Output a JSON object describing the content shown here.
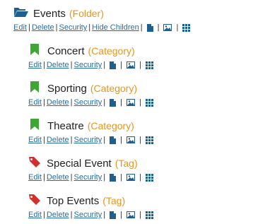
{
  "folder": {
    "name": "Events",
    "type": "(Folder)",
    "icon": "folder-open-icon",
    "actions": [
      "Edit",
      "Delete",
      "Security",
      "Hide Children"
    ]
  },
  "children": [
    {
      "name": "Concert",
      "type": "(Category)",
      "icon": "bookmark-icon",
      "color": "#3fa535",
      "actions": [
        "Edit",
        "Delete",
        "Security"
      ]
    },
    {
      "name": "Sporting",
      "type": "(Category)",
      "icon": "bookmark-icon",
      "color": "#3fa535",
      "actions": [
        "Edit",
        "Delete",
        "Security"
      ]
    },
    {
      "name": "Theatre",
      "type": "(Category)",
      "icon": "bookmark-icon",
      "color": "#3fa535",
      "actions": [
        "Edit",
        "Delete",
        "Security"
      ]
    },
    {
      "name": "Special Event",
      "type": "(Tag)",
      "icon": "tag-icon",
      "color": "#d0312d",
      "actions": [
        "Edit",
        "Delete",
        "Security"
      ]
    },
    {
      "name": "Top Events",
      "type": "(Tag)",
      "icon": "tag-icon",
      "color": "#d0312d",
      "actions": [
        "Edit",
        "Delete",
        "Security"
      ]
    }
  ],
  "action_icons": [
    "document-icon",
    "image-icon",
    "grid-icon"
  ],
  "colors": {
    "link": "#2a6ea0",
    "type_label": "#e8951d",
    "icon_blue": "#1f5f8f"
  }
}
